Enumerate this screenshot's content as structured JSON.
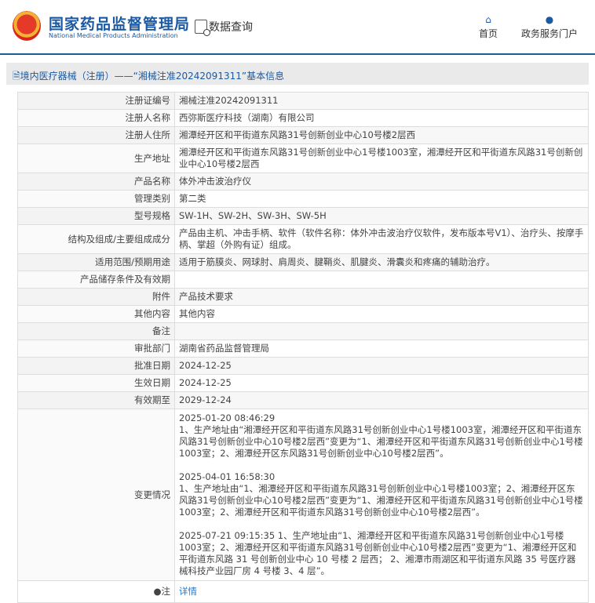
{
  "header": {
    "logo_cn": "国家药品监督管理局",
    "logo_en": "National Medical Products Administration",
    "data_query": "数据查询",
    "nav": [
      {
        "label": "首页",
        "icon": "home-icon"
      },
      {
        "label": "政务服务门户",
        "icon": "user-icon"
      }
    ]
  },
  "breadcrumb": "境内医疗器械（注册）——“湘械注准20242091311”基本信息",
  "rows": [
    {
      "label": "注册证编号",
      "value": "湘械注准20242091311"
    },
    {
      "label": "注册人名称",
      "value": "西弥斯医疗科技（湖南）有限公司"
    },
    {
      "label": "注册人住所",
      "value": "湘潭经开区和平街道东风路31号创新创业中心10号楼2层西"
    },
    {
      "label": "生产地址",
      "value": "湘潭经开区和平街道东风路31号创新创业中心1号楼1003室，湘潭经开区和平街道东风路31号创新创业中心10号楼2层西"
    },
    {
      "label": "产品名称",
      "value": "体外冲击波治疗仪"
    },
    {
      "label": "管理类别",
      "value": "第二类"
    },
    {
      "label": "型号规格",
      "value": "SW-1H、SW-2H、SW-3H、SW-5H"
    },
    {
      "label": "结构及组成/主要组成成分",
      "value": "产品由主机、冲击手柄、软件（软件名称：体外冲击波治疗仪软件，发布版本号V1）、治疗头、按摩手柄、掌超（外购有证）组成。"
    },
    {
      "label": "适用范围/预期用途",
      "value": "适用于筋膜炎、网球肘、肩周炎、腱鞘炎、肌腱炎、滑囊炎和疼痛的辅助治疗。"
    },
    {
      "label": "产品储存条件及有效期",
      "value": ""
    },
    {
      "label": "附件",
      "value": "产品技术要求"
    },
    {
      "label": "其他内容",
      "value": "其他内容"
    },
    {
      "label": "备注",
      "value": ""
    },
    {
      "label": "审批部门",
      "value": "湖南省药品监督管理局"
    },
    {
      "label": "批准日期",
      "value": "2024-12-25"
    },
    {
      "label": "生效日期",
      "value": "2024-12-25"
    },
    {
      "label": "有效期至",
      "value": "2029-12-24"
    }
  ],
  "changes": {
    "label": "变更情况",
    "entries": [
      {
        "time": "2025-01-20 08:46:29",
        "text": "1、生产地址由“湘潭经开区和平街道东风路31号创新创业中心1号楼1003室，湘潭经开区和平街道东风路31号创新创业中心10号楼2层西”变更为“1、湘潭经开区和平街道东风路31号创新创业中心1号楼1003室；2、湘潭经开区东风路31号创新创业中心10号楼2层西”。"
      },
      {
        "time": "2025-04-01 16:58:30",
        "text": "1、生产地址由“1、湘潭经开区和平街道东风路31号创新创业中心1号楼1003室；2、湘潭经开区东风路31号创新创业中心10号楼2层西”变更为“1、湘潭经开区和平街道东风路31号创新创业中心1号楼1003室；2、湘潭经开区和平街道东风路31号创新创业中心10号楼2层西”。"
      },
      {
        "time": "2025-07-21 09:15:35",
        "text": "1、生产地址由“1、湘潭经开区和平街道东风路31号创新创业中心1号楼1003室；2、湘潭经开区和平街道东风路31号创新创业中心10号楼2层西”变更为“1、湘潭经开区和平街道东风路 31 号创新创业中心 10 号楼 2 层西； 2、湘潭市雨湖区和平街道东风路 35 号医疗器械科技产业园厂房 4 号楼 3、4 层”。"
      }
    ]
  },
  "note": {
    "label": "注",
    "link": "详情"
  }
}
